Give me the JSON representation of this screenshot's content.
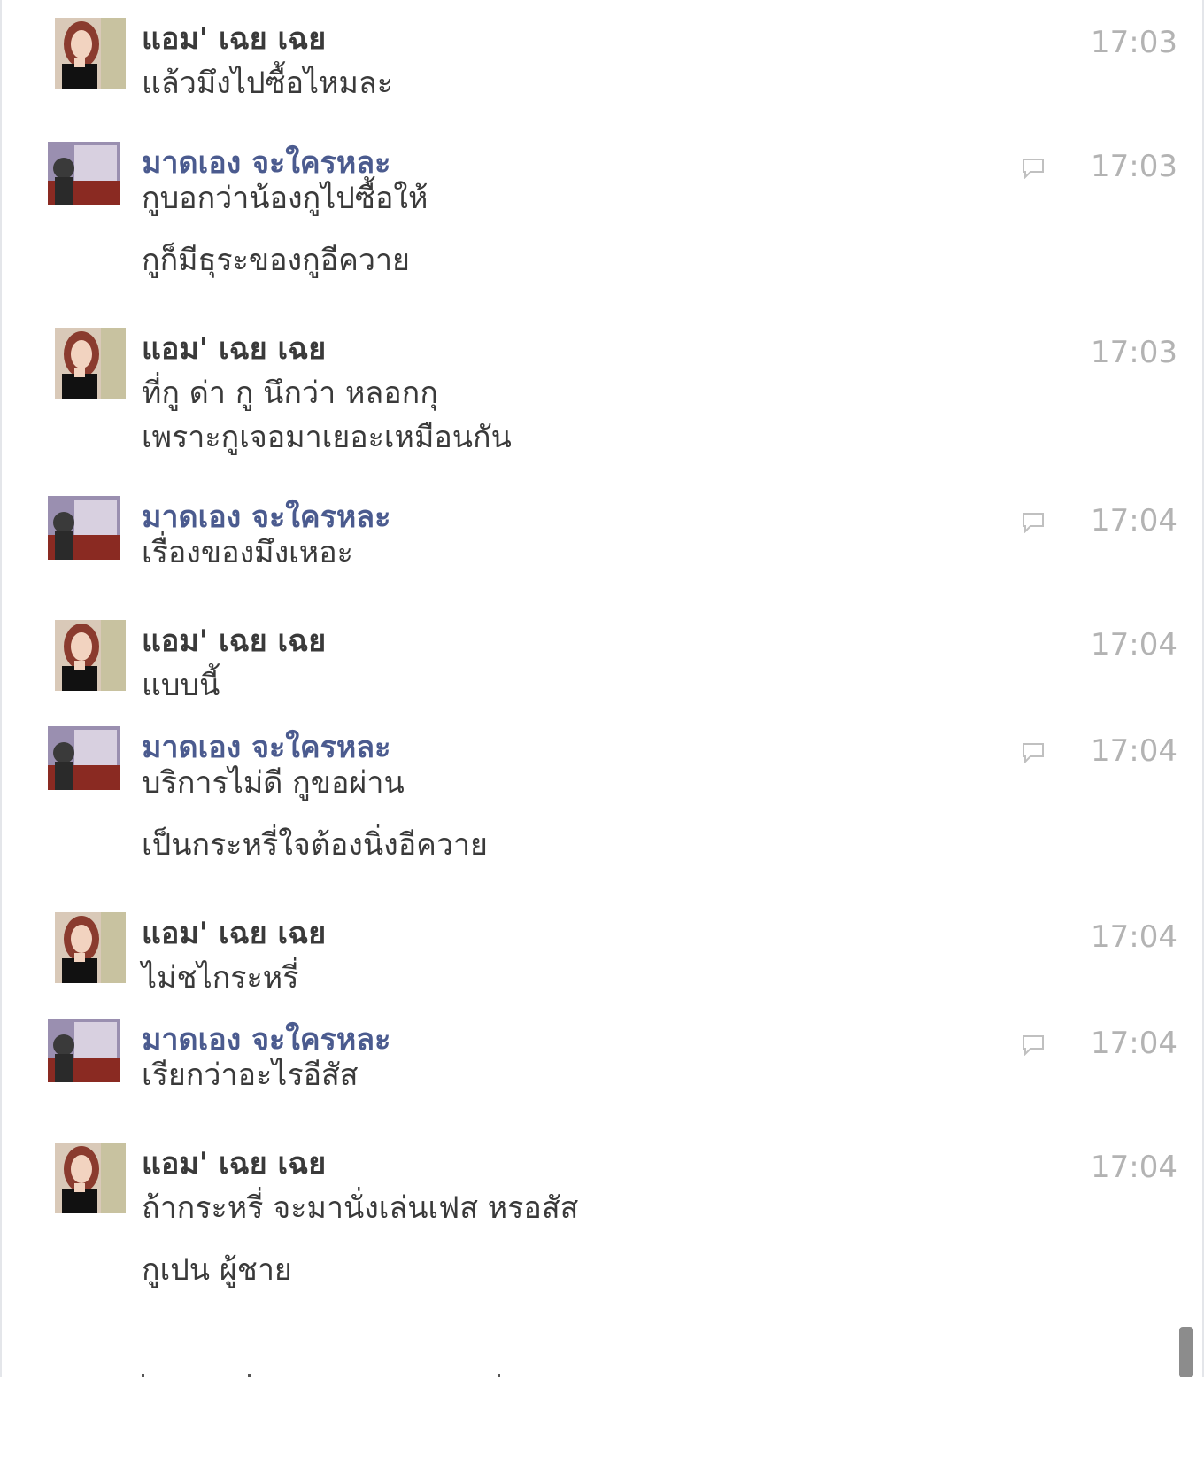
{
  "colors": {
    "girl_name": "#3a3a3a",
    "guy_name": "#4b5b8f",
    "message_text": "#3a3a3a",
    "timestamp": "#b3b3b3",
    "scrollbar": "#8c8c8c"
  },
  "messages": [
    {
      "sender": "แอม' เฉย เฉย",
      "time": "17:03",
      "lines": [
        "แล้วมึงไปซื้อไหมละ"
      ]
    },
    {
      "sender": "มาดเอง จะใครหละ",
      "time": "17:03",
      "lines": [
        "กูบอกว่าน้องกูไปซื้อให้",
        "กูก็มีธุระของกูอีควาย"
      ]
    },
    {
      "sender": "แอม' เฉย เฉย",
      "time": "17:03",
      "lines": [
        "ที่กู ด่า กู นึกว่า หลอกกุ",
        "เพราะกูเจอมาเยอะเหมือนกัน"
      ]
    },
    {
      "sender": "มาดเอง จะใครหละ",
      "time": "17:04",
      "lines": [
        "เรื่องของมึงเหอะ"
      ]
    },
    {
      "sender": "แอม' เฉย เฉย",
      "time": "17:04",
      "lines": [
        "แบบนี้"
      ]
    },
    {
      "sender": "มาดเอง จะใครหละ",
      "time": "17:04",
      "lines": [
        "บริการไม่ดี กูขอผ่าน",
        "เป็นกระหรี่ใจต้องนิ่งอีควาย"
      ]
    },
    {
      "sender": "แอม' เฉย เฉย",
      "time": "17:04",
      "lines": [
        "ไม่ชไกระหรี่"
      ]
    },
    {
      "sender": "มาดเอง จะใครหละ",
      "time": "17:04",
      "lines": [
        "เรียกว่าอะไรอีสัส"
      ]
    },
    {
      "sender": "แอม' เฉย เฉย",
      "time": "17:04",
      "lines": [
        "ถ้ากระหรี่ จะมานั่งเล่นเฟส หรอสัส",
        "กูเปน ผู้ชาย"
      ]
    }
  ]
}
